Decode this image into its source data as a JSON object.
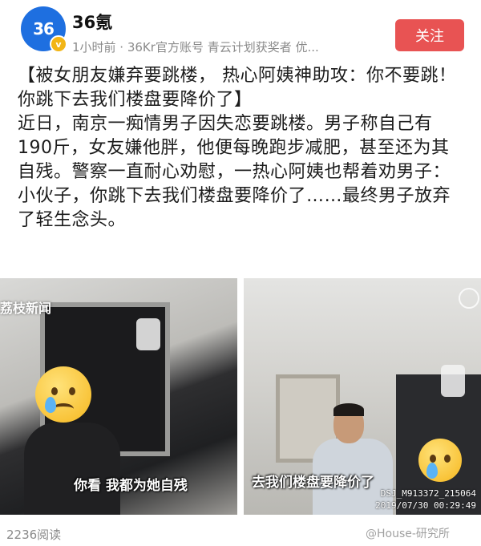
{
  "account": {
    "avatar_text": "36",
    "avatar_badge": "v",
    "name": "36氪",
    "meta": "1小时前 · 36Kr官方账号 青云计划获奖者 优..."
  },
  "follow_label": "关注",
  "post": {
    "headline": "【被女朋友嫌弃要跳楼， 热心阿姨神助攻：你不要跳！你跳下去我们楼盘要降价了】",
    "body": "近日，南京一痴情男子因失恋要跳楼。男子称自己有190斤，女友嫌他胖，他便每晚跑步减肥，甚至还为其自残。警察一直耐心劝慰，一热心阿姨也帮着劝男子：小伙子，你跳下去我们楼盘要降价了……最终男子放弃了轻生念头。"
  },
  "images": {
    "left": {
      "watermark": "荔枝新闻",
      "subtitle": "你看 我都为她自残"
    },
    "right": {
      "subtitle": "去我们楼盘要降价了",
      "stamp_id": "DSJ_M913372_215064",
      "stamp_time": "2019/07/30 00:29:49"
    }
  },
  "footer": {
    "read_count": "2236阅读",
    "watermark": "@House-研究所"
  },
  "colors": {
    "accent": "#e85353",
    "avatar": "#1e6fe0",
    "meta_text": "#8a8a8a"
  }
}
